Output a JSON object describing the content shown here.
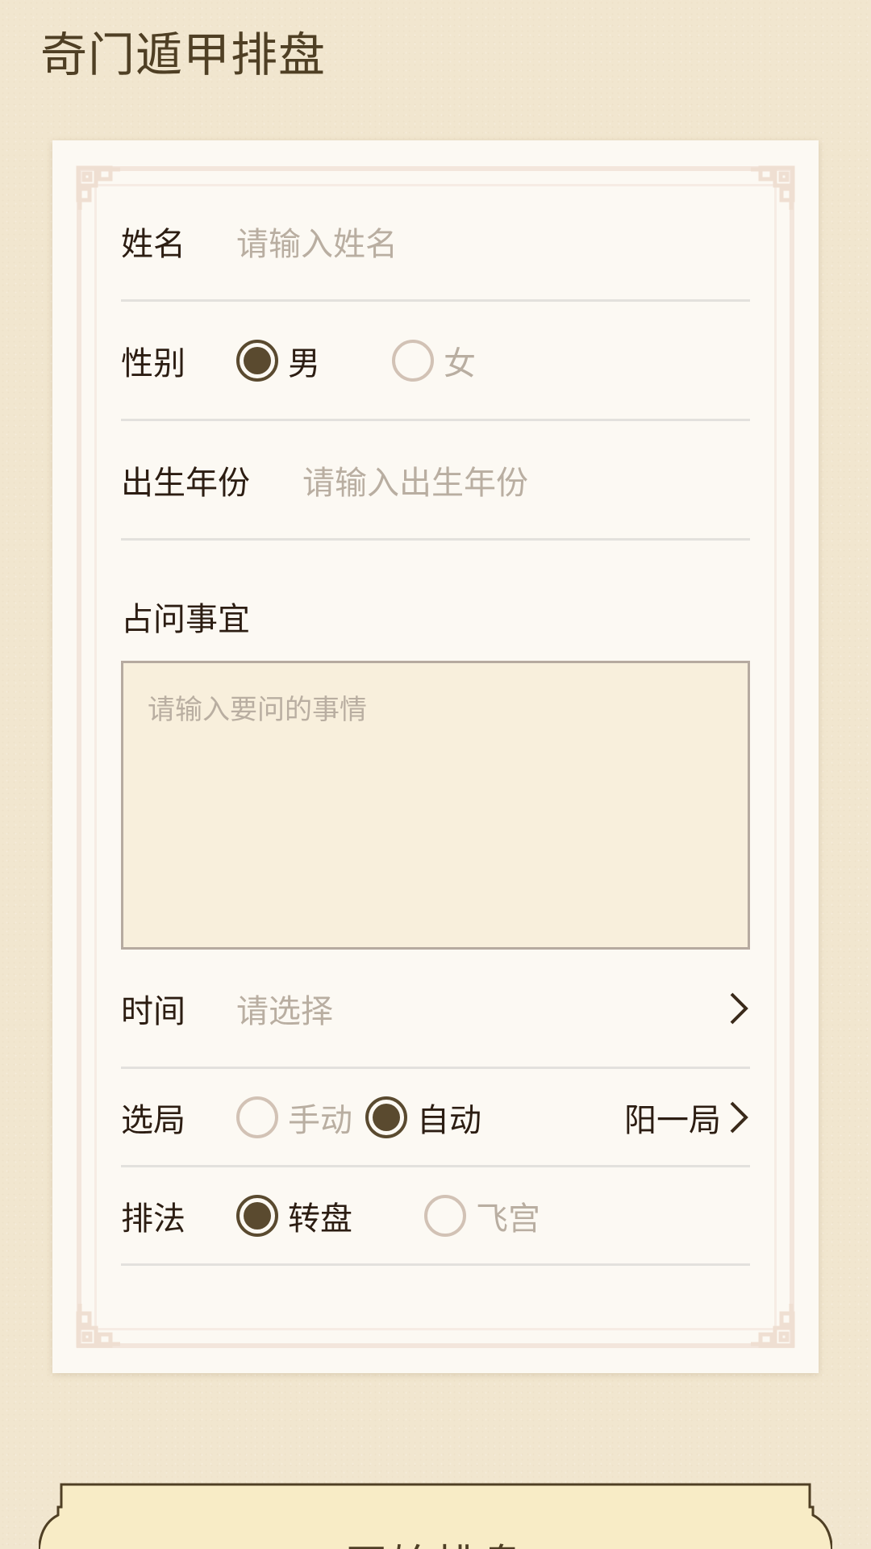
{
  "header": {
    "title": "奇门遁甲排盘"
  },
  "form": {
    "name": {
      "label": "姓名",
      "placeholder": "请输入姓名"
    },
    "gender": {
      "label": "性别",
      "options": [
        {
          "label": "男",
          "selected": true
        },
        {
          "label": "女",
          "selected": false
        }
      ]
    },
    "birth_year": {
      "label": "出生年份",
      "placeholder": "请输入出生年份"
    },
    "question": {
      "label": "占问事宜",
      "placeholder": "请输入要问的事情"
    },
    "time": {
      "label": "时间",
      "placeholder": "请选择"
    },
    "ju_selection": {
      "label": "选局",
      "options": [
        {
          "label": "手动",
          "selected": false
        },
        {
          "label": "自动",
          "selected": true
        }
      ],
      "value": "阳一局"
    },
    "method": {
      "label": "排法",
      "options": [
        {
          "label": "转盘",
          "selected": true
        },
        {
          "label": "飞宫",
          "selected": false
        }
      ]
    }
  },
  "actions": {
    "start_label": "开始排盘"
  },
  "colors": {
    "brand_dark": "#5a4a2f",
    "text_dark": "#2c1d12",
    "placeholder": "#b9aea1",
    "background": "#f1e6cf",
    "card": "#fcf9f3",
    "textarea_bg": "#f8efdc"
  }
}
